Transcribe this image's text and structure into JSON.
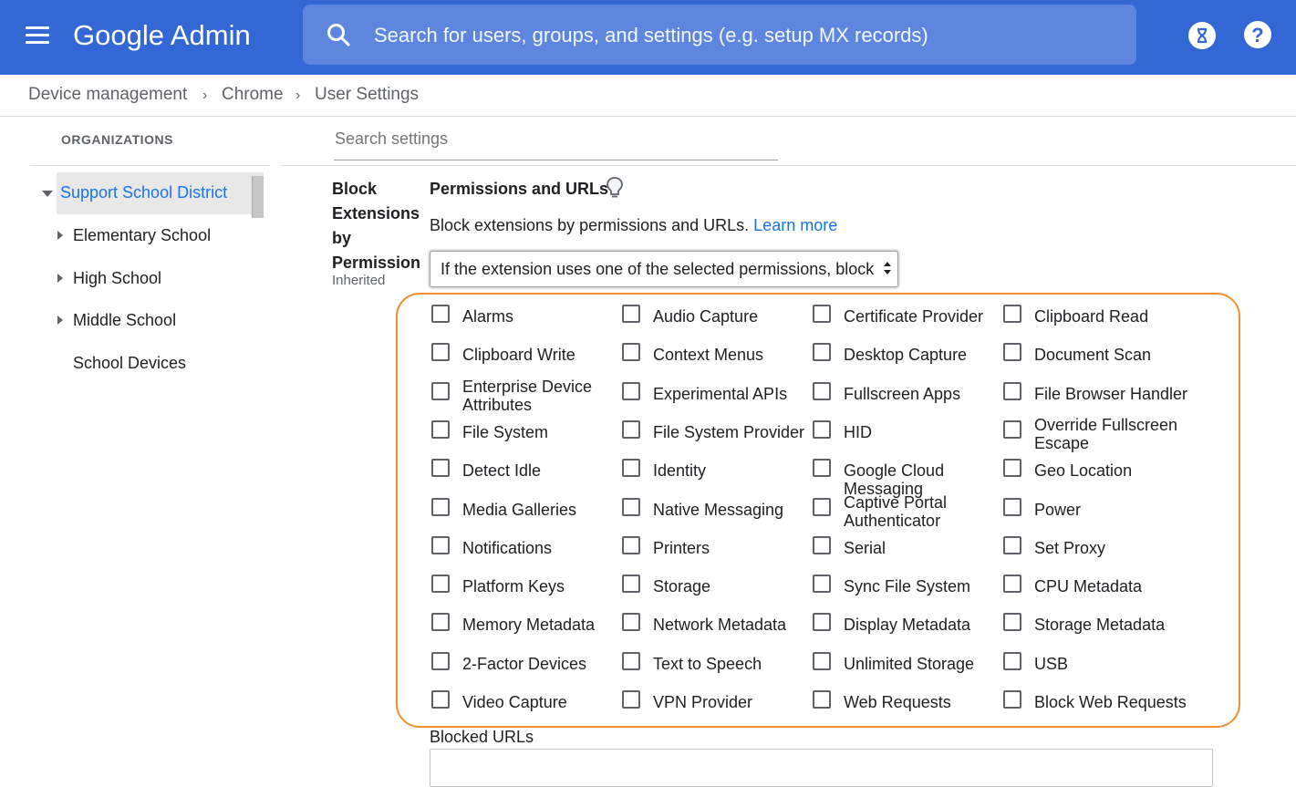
{
  "header": {
    "logo": "Google Admin",
    "search_placeholder": "Search for users, groups, and settings (e.g. setup MX records)"
  },
  "breadcrumb": [
    "Device management",
    "Chrome",
    "User Settings"
  ],
  "organizations": {
    "heading": "ORGANIZATIONS",
    "root": "Support School District",
    "children": [
      "Elementary School",
      "High School",
      "Middle School",
      "School Devices"
    ]
  },
  "settings_search_placeholder": "Search settings",
  "setting": {
    "name": "Block Extensions by Permission",
    "status": "Inherited",
    "section_title": "Permissions and URLs",
    "description": "Block extensions by permissions and URLs.",
    "learn_more": "Learn more",
    "dropdown_value": "If the extension uses one of the selected permissions, block it"
  },
  "permissions": [
    [
      "Alarms",
      "Audio Capture",
      "Certificate Provider",
      "Clipboard Read"
    ],
    [
      "Clipboard Write",
      "Context Menus",
      "Desktop Capture",
      "Document Scan"
    ],
    [
      "Enterprise Device Attributes",
      "Experimental APIs",
      "Fullscreen Apps",
      "File Browser Handler"
    ],
    [
      "File System",
      "File System Provider",
      "HID",
      "Override Fullscreen Escape"
    ],
    [
      "Detect Idle",
      "Identity",
      "Google Cloud Messaging",
      "Geo Location"
    ],
    [
      "Media Galleries",
      "Native Messaging",
      "Captive Portal Authenticator",
      "Power"
    ],
    [
      "Notifications",
      "Printers",
      "Serial",
      "Set Proxy"
    ],
    [
      "Platform Keys",
      "Storage",
      "Sync File System",
      "CPU Metadata"
    ],
    [
      "Memory Metadata",
      "Network Metadata",
      "Display Metadata",
      "Storage Metadata"
    ],
    [
      "2-Factor Devices",
      "Text to Speech",
      "Unlimited Storage",
      "USB"
    ],
    [
      "Video Capture",
      "VPN Provider",
      "Web Requests",
      "Block Web Requests"
    ]
  ],
  "blocked_urls_label": "Blocked URLs",
  "colors": {
    "topbar": "#3367d6",
    "link": "#1a73e8",
    "highlight": "#f0902f"
  }
}
